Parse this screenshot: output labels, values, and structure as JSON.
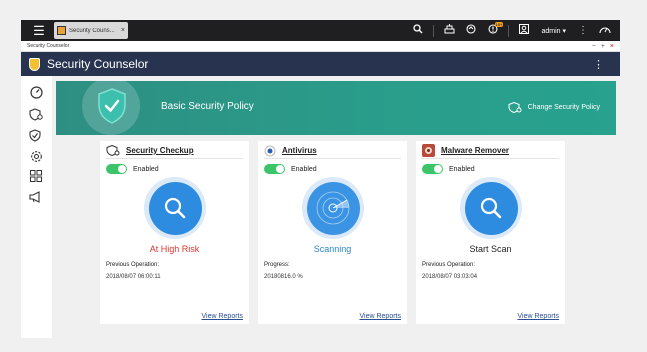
{
  "tab": {
    "label": "Security Couns..."
  },
  "topbar": {
    "user": "admin",
    "notification_count": "10+"
  },
  "window": {
    "title": "Security Counselor",
    "controls": {
      "minimize": "−",
      "maximize": "+",
      "close": "×"
    }
  },
  "app": {
    "title": "Security Counselor"
  },
  "rail": [
    {
      "name": "dashboard-icon"
    },
    {
      "name": "shield-settings-icon"
    },
    {
      "name": "shield-check-icon"
    },
    {
      "name": "gear-icon"
    },
    {
      "name": "apps-icon"
    },
    {
      "name": "megaphone-icon"
    }
  ],
  "banner": {
    "title": "Basic Security Policy",
    "change_label": "Change Security Policy"
  },
  "cards": [
    {
      "title": "Security Checkup",
      "toggle_label": "Enabled",
      "status": "At High Risk",
      "info_label": "Previous Operation:",
      "info_value": "2018/08/07 06:00:11",
      "report_label": "View Reports"
    },
    {
      "title": "Antivirus",
      "toggle_label": "Enabled",
      "status": "Scanning",
      "info_label": "Progress:",
      "info_value": "20180816.0 %",
      "report_label": "View Reports"
    },
    {
      "title": "Malware Remover",
      "toggle_label": "Enabled",
      "status": "Start Scan",
      "info_label": "Previous Operation:",
      "info_value": "2018/08/07 03:03:04",
      "report_label": "View Reports"
    }
  ],
  "colors": {
    "banner": "#2a9d8b",
    "header": "#283350",
    "risk": "#d9382f",
    "scanning": "#2b86c9",
    "toggle_on": "#3cc46a"
  }
}
